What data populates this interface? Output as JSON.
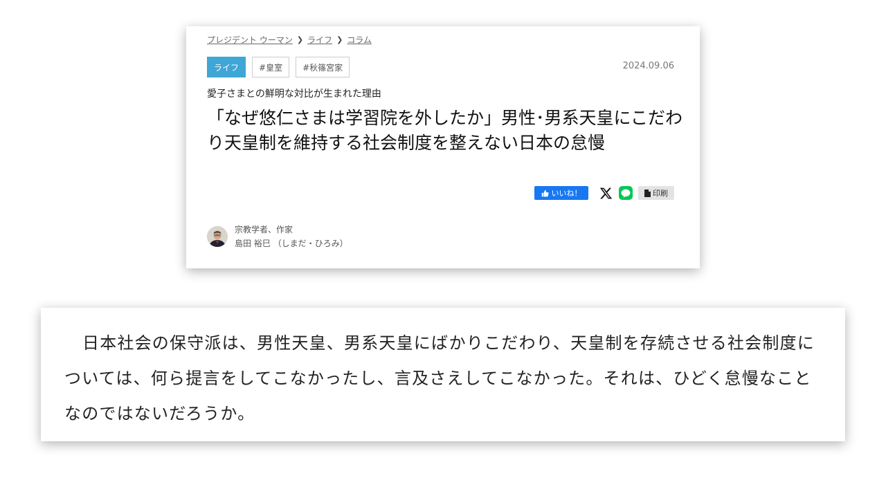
{
  "breadcrumb": [
    "プレジデント ウーマン",
    "ライフ",
    "コラム"
  ],
  "tags": [
    "ライフ",
    "#皇室",
    "#秋篠宮家"
  ],
  "date": "2024.09.06",
  "subtitle": "愛子さまとの鮮明な対比が生まれた理由",
  "title": "「なぜ悠仁さまは学習院を外したか」男性･男系天皇にこだわり天皇制を維持する社会制度を整えない日本の怠慢",
  "share": {
    "like_label": "いいね！",
    "print_label": "印刷"
  },
  "author": {
    "role": "宗教学者、作家",
    "name": "島田 裕巳 （しまだ・ひろみ）"
  },
  "quote": "日本社会の保守派は、男性天皇、男系天皇にばかりこだわり、天皇制を存続させる社会制度については、何ら提言をしてこなかったし、言及さえしてこなかった。それは、ひどく怠慢なことなのではないだろうか。",
  "colors": {
    "tag_primary": "#3fa6d6",
    "like": "#1877f2",
    "line": "#06c755"
  }
}
